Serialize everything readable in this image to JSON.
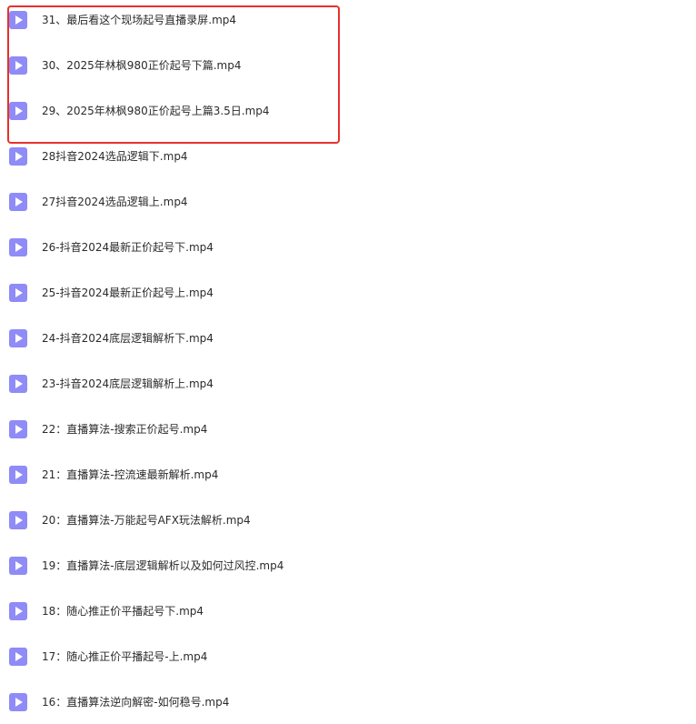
{
  "files": [
    {
      "name": "31、最后看这个现场起号直播录屏.mp4",
      "icon": "video-file-icon"
    },
    {
      "name": "30、2025年林枫980正价起号下篇.mp4",
      "icon": "video-file-icon"
    },
    {
      "name": "29、2025年林枫980正价起号上篇3.5日.mp4",
      "icon": "video-file-icon"
    },
    {
      "name": "28抖音2024选品逻辑下.mp4",
      "icon": "video-file-icon"
    },
    {
      "name": "27抖音2024选品逻辑上.mp4",
      "icon": "video-file-icon"
    },
    {
      "name": "26-抖音2024最新正价起号下.mp4",
      "icon": "video-file-icon"
    },
    {
      "name": "25-抖音2024最新正价起号上.mp4",
      "icon": "video-file-icon"
    },
    {
      "name": "24-抖音2024底层逻辑解析下.mp4",
      "icon": "video-file-icon"
    },
    {
      "name": "23-抖音2024底层逻辑解析上.mp4",
      "icon": "video-file-icon"
    },
    {
      "name": "22：直播算法-搜索正价起号.mp4",
      "icon": "video-file-icon"
    },
    {
      "name": "21：直播算法-控流速最新解析.mp4",
      "icon": "video-file-icon"
    },
    {
      "name": "20：直播算法-万能起号AFX玩法解析.mp4",
      "icon": "video-file-icon"
    },
    {
      "name": "19：直播算法-底层逻辑解析以及如何过风控.mp4",
      "icon": "video-file-icon"
    },
    {
      "name": "18：随心推正价平播起号下.mp4",
      "icon": "video-file-icon"
    },
    {
      "name": "17：随心推正价平播起号-上.mp4",
      "icon": "video-file-icon"
    },
    {
      "name": "16：直播算法逆向解密-如何稳号.mp4",
      "icon": "video-file-icon"
    }
  ],
  "colors": {
    "icon": "#8f8bf7",
    "highlight": "#e8302b",
    "text": "#2b2b2b"
  }
}
